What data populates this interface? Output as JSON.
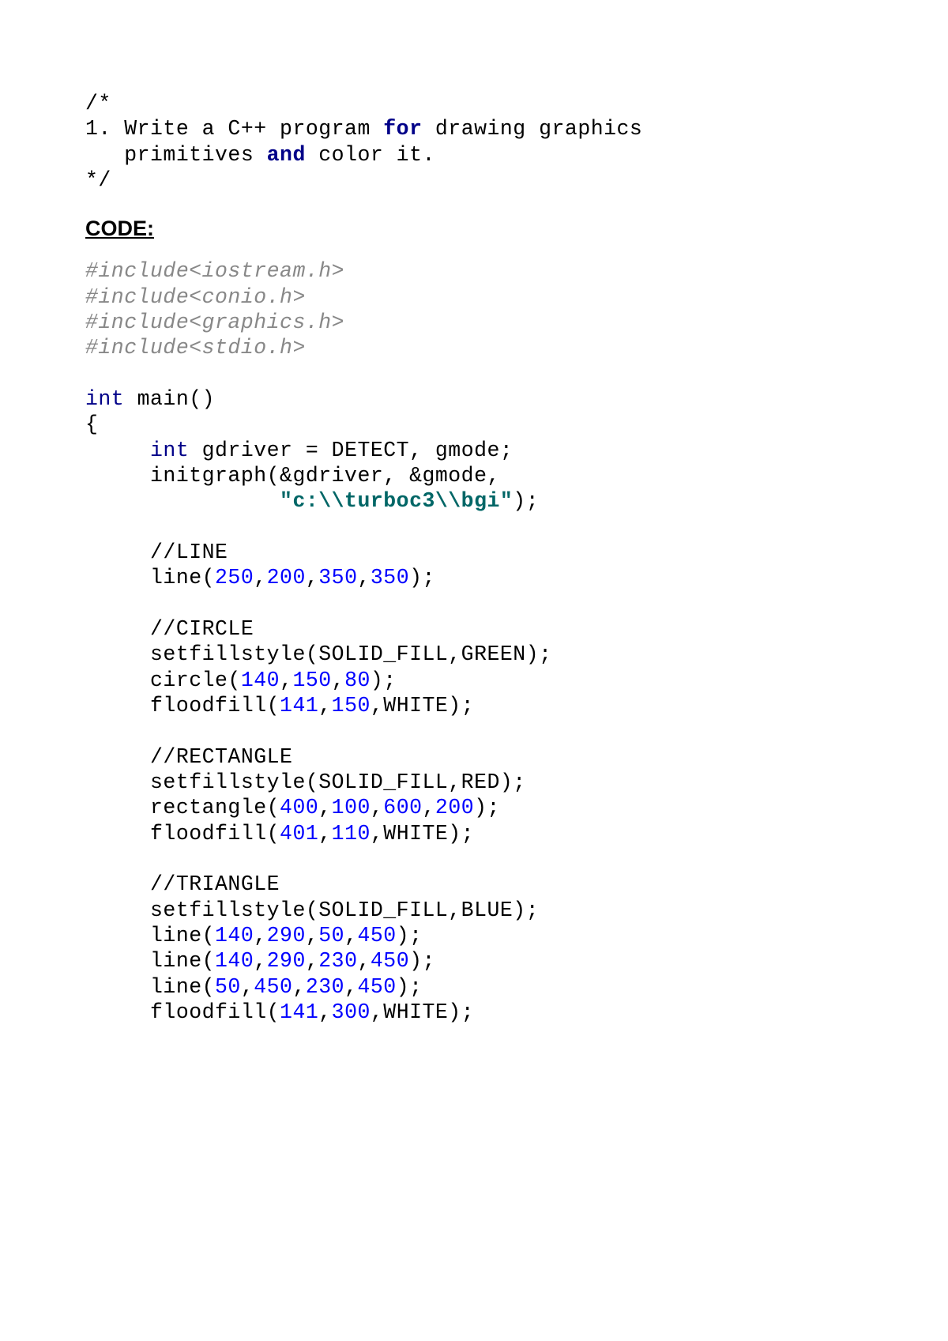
{
  "comment_block": {
    "open": "/*",
    "line1_a": "1. Write a C++ program ",
    "line1_for": "for",
    "line1_b": " drawing graphics",
    "line2_a": "   primitives ",
    "line2_and": "and",
    "line2_b": " color it.",
    "close": "*/"
  },
  "heading": "CODE:",
  "includes": {
    "l1": "#include<iostream.h>",
    "l2": "#include<conio.h>",
    "l3": "#include<graphics.h>",
    "l4": "#include<stdio.h>"
  },
  "main": {
    "int": "int",
    "main_sig": " main()",
    "brace": "{",
    "indent": "     ",
    "gdriver_a": " gdriver = DETECT, gmode;",
    "initgraph": "     initgraph(&gdriver, &gmode,",
    "str_pad": "               ",
    "str": "\"c:\\\\turboc3\\\\bgi\"",
    "str_close": ");",
    "cm_line": "     //LINE",
    "line_call_a": "     line(",
    "n250": "250",
    "comma": ",",
    "n200": "200",
    "n350": "350",
    "close_stmt": ");",
    "cm_circle": "     //CIRCLE",
    "setfill_green": "     setfillstyle(SOLID_FILL,GREEN);",
    "circle_a": "     circle(",
    "n140": "140",
    "n150": "150",
    "n80": "80",
    "flood1_a": "     floodfill(",
    "n141": "141",
    "flood1_b": ",WHITE);",
    "cm_rect": "     //RECTANGLE",
    "setfill_red": "     setfillstyle(SOLID_FILL,RED);",
    "rect_a": "     rectangle(",
    "n400": "400",
    "n100": "100",
    "n600": "600",
    "flood2_a": "     floodfill(",
    "n401": "401",
    "n110": "110",
    "cm_tri": "     //TRIANGLE",
    "setfill_blue": "     setfillstyle(SOLID_FILL,BLUE);",
    "n290": "290",
    "n50": "50",
    "n450": "450",
    "n230": "230",
    "n300": "300"
  }
}
